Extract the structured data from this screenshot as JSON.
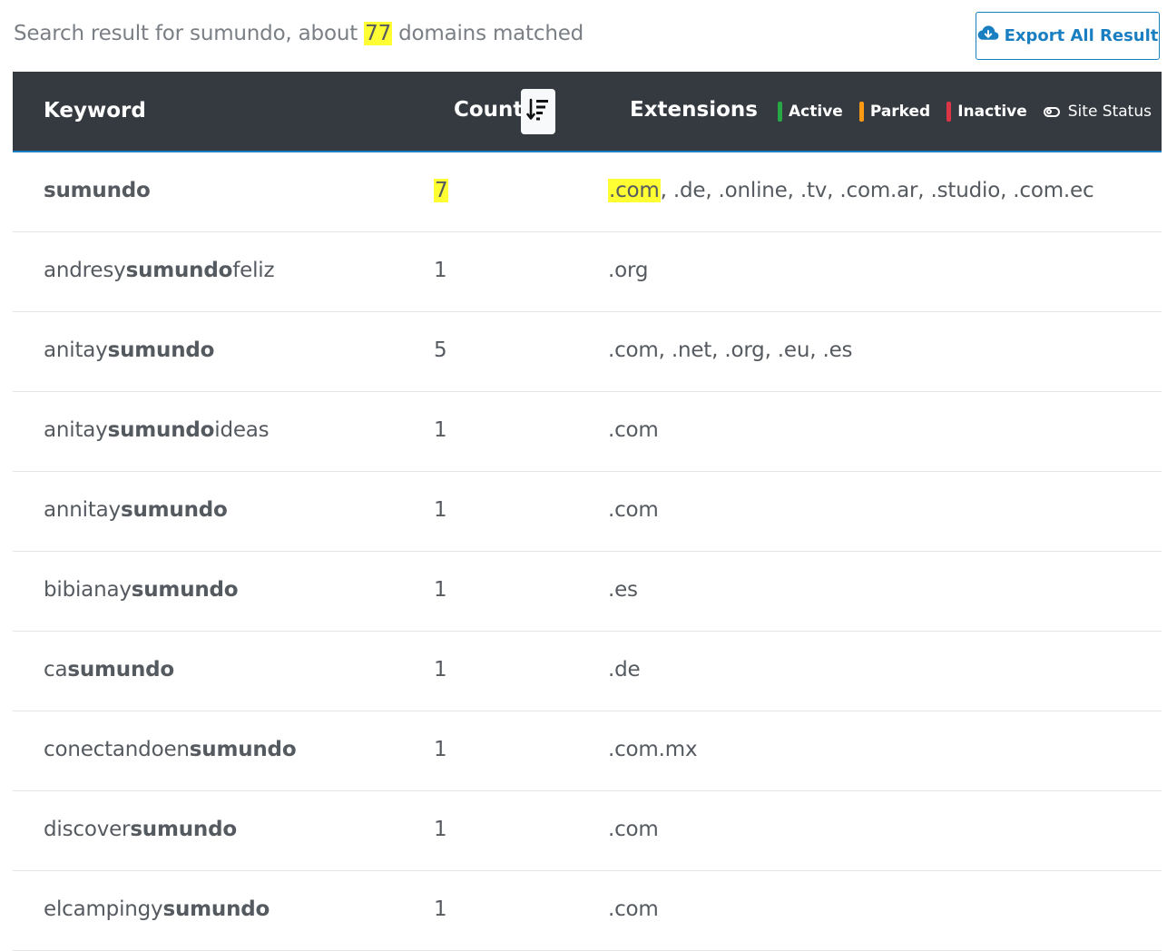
{
  "summary": {
    "prefix": "Search result for sumundo, about ",
    "count": "77",
    "suffix": " domains matched"
  },
  "export_button": {
    "label": "Export All Result",
    "icon": "cloud-download-icon"
  },
  "table": {
    "headers": {
      "keyword": "Keyword",
      "count": "Count",
      "extensions": "Extensions"
    },
    "sort_icon": "sort-descending-icon",
    "legend": [
      {
        "label": "Active",
        "color": "#28a745"
      },
      {
        "label": "Parked",
        "color": "#fd9a14"
      },
      {
        "label": "Inactive",
        "color": "#dc3545"
      }
    ],
    "site_status": {
      "label": "Site Status",
      "icon": "toggle-icon"
    },
    "rows": [
      {
        "pre": "",
        "match": "sumundo",
        "post": "",
        "count": "7",
        "ext_first": ".com",
        "ext_rest": ", .de, .online, .tv, .com.ar, .studio, .com.ec"
      },
      {
        "pre": "andresy",
        "match": "sumundo",
        "post": "feliz",
        "count": "1",
        "ext_first": ".org",
        "ext_rest": ""
      },
      {
        "pre": "anitay",
        "match": "sumundo",
        "post": "",
        "count": "5",
        "ext_first": ".com",
        "ext_rest": ", .net, .org, .eu, .es"
      },
      {
        "pre": "anitay",
        "match": "sumundo",
        "post": "ideas",
        "count": "1",
        "ext_first": ".com",
        "ext_rest": ""
      },
      {
        "pre": "annitay",
        "match": "sumundo",
        "post": "",
        "count": "1",
        "ext_first": ".com",
        "ext_rest": ""
      },
      {
        "pre": "bibianay",
        "match": "sumundo",
        "post": "",
        "count": "1",
        "ext_first": ".es",
        "ext_rest": ""
      },
      {
        "pre": "ca",
        "match": "sumundo",
        "post": "",
        "count": "1",
        "ext_first": ".de",
        "ext_rest": ""
      },
      {
        "pre": "conectandoen",
        "match": "sumundo",
        "post": "",
        "count": "1",
        "ext_first": ".com.mx",
        "ext_rest": ""
      },
      {
        "pre": "discover",
        "match": "sumundo",
        "post": "",
        "count": "1",
        "ext_first": ".com",
        "ext_rest": ""
      },
      {
        "pre": "elcampingy",
        "match": "sumundo",
        "post": "",
        "count": "1",
        "ext_first": ".com",
        "ext_rest": ""
      }
    ]
  }
}
